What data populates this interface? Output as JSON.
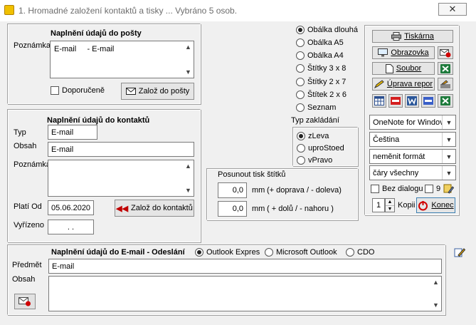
{
  "window": {
    "title": "1. Hromadné založení kontaktů a tisky ... Vybráno 5 osob.",
    "close_symbol": "✕"
  },
  "mail_panel": {
    "title": "Naplnění údajů do pošty",
    "note_label": "Poznámka",
    "note_value": "E-mail     - E-mail",
    "recommended_label": "Doporučeně",
    "create_button": "Založ do pošty"
  },
  "contacts_panel": {
    "title": "Naplnění údajů do kontaktů",
    "type_label": "Typ",
    "type_value": "E-mail",
    "content_label": "Obsah",
    "content_value": "E-mail",
    "note_label": "Poznámka",
    "valid_from_label": "Platí Od",
    "valid_from_value": "05.06.2020",
    "done_label": "Vyřízeno",
    "done_value": ". .",
    "create_button": "Založ do kontaktů"
  },
  "print_types": {
    "options": [
      "Obálka dlouhá",
      "Obálka A5",
      "Obálka A4",
      "Štítky 3 x 8",
      "Štítky 2 x 7",
      "Štítek 2 x 6",
      "Seznam"
    ],
    "selected_index": 0
  },
  "insert_type": {
    "title": "Typ zakládání",
    "options": [
      "zLeva",
      "uproStoed",
      "vPravo"
    ],
    "selected_index": 0
  },
  "shift_panel": {
    "title": "Posunout tisk štítků",
    "x_value": "0,0",
    "x_unit": "mm",
    "x_hint": "(+ doprava / - doleva)",
    "y_value": "0,0",
    "y_unit": "mm",
    "y_hint": "( + dolů / - nahoru )"
  },
  "output_panel": {
    "printer_button": "Tiskárna",
    "screen_button": "Obrazovka",
    "file_button": "Soubor",
    "edit_report_button": "Úprava repor",
    "combos": [
      "OneNote for Windov",
      "Čeština",
      "neměnit formát",
      "čáry všechny"
    ],
    "no_dialog_label": "Bez dialogu",
    "nine_label": "9",
    "copies_value": "1",
    "copies_label": "Kopii",
    "end_button": "Konec"
  },
  "email_panel": {
    "title": "Naplnění údajů do E-mail - Odeslání",
    "options": [
      "Outlook Expres",
      "Microsoft Outlook",
      "CDO"
    ],
    "selected_index": 0,
    "subject_label": "Předmět",
    "subject_value": "E-mail",
    "content_label": "Obsah"
  }
}
